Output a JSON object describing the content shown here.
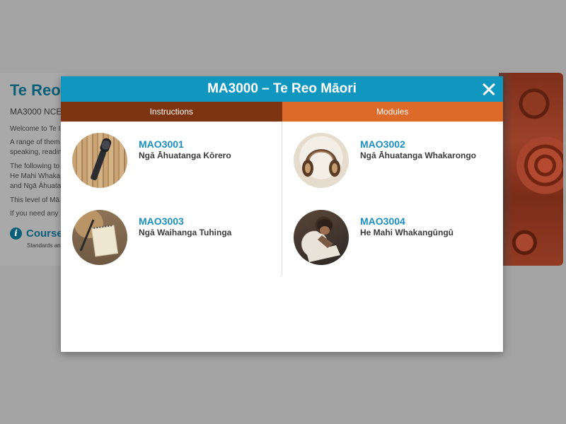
{
  "background_page": {
    "title": "Te Reo",
    "subtitle": "MA3000 NCE",
    "paragraphs": [
      "Welcome to Te I",
      "A range of them",
      "speaking, readin",
      "The following to",
      "He Mahi Whaka",
      "and Ngā Āhuata",
      "This level of Mā",
      "If you need any"
    ],
    "course_heading": "Course",
    "course_subtext": "Standards an",
    "info_icon_glyph": "i"
  },
  "modal": {
    "title": "MA3000 – Te Reo Māori",
    "close_icon": "close-icon",
    "tabs": [
      {
        "label": "Instructions",
        "color": "#7d3511"
      },
      {
        "label": "Modules",
        "color": "#dd6a28",
        "active": true
      }
    ],
    "modules": [
      {
        "code": "MAO3001",
        "name": "Ngā Āhuatanga Kōrero",
        "image": "microphone-image"
      },
      {
        "code": "MAO3002",
        "name": "Ngā Āhuatanga Whakarongo",
        "image": "headphones-image"
      },
      {
        "code": "MAO3003",
        "name": "Ngā Waihanga Tuhinga",
        "image": "notebook-pen-image"
      },
      {
        "code": "MAO3004",
        "name": "He Mahi Whakangūngū",
        "image": "person-writing-image"
      }
    ]
  },
  "colors": {
    "header_blue": "#1197bf",
    "module_code_blue": "#1a8fc0",
    "tab_brown": "#7d3511",
    "tab_orange": "#dd6a28",
    "overlay_gray": "#a3a3a3"
  }
}
